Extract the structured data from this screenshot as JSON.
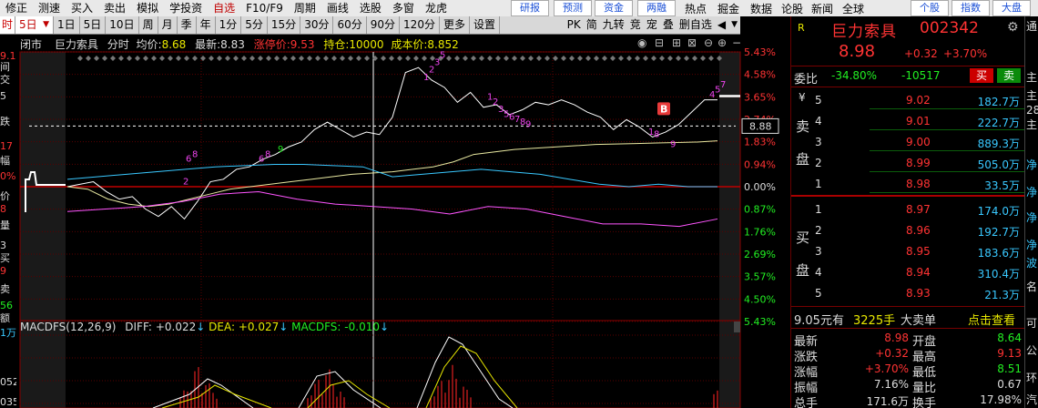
{
  "menu": {
    "items": [
      "修正",
      "测速",
      "买入",
      "卖出",
      "模拟",
      "学投资",
      "自选",
      "F10/F9",
      "周期",
      "画线",
      "选股",
      "多窗",
      "龙虎"
    ],
    "right_buttons": [
      "研报",
      "预测",
      "资金",
      "两融"
    ],
    "right_items": [
      "热点",
      "掘金",
      "数据",
      "论股",
      "新闻",
      "全球"
    ],
    "far_buttons": [
      "个股",
      "指数",
      "大盘"
    ]
  },
  "toolbar": {
    "periods": [
      "5日",
      "1日",
      "5日",
      "10日",
      "周",
      "月",
      "季",
      "年",
      "1分",
      "5分",
      "15分",
      "30分",
      "60分",
      "90分",
      "120分",
      "更多",
      "设置"
    ],
    "active_index": 0,
    "right_items": [
      "PK",
      "简",
      "九转",
      "竞",
      "宠",
      "叠",
      "删自选"
    ]
  },
  "left_strip": {
    "top_tab": "时",
    "items": [
      {
        "t": "9.13",
        "c": "#ff3333"
      },
      {
        "t": "间",
        "c": "#ddd"
      },
      {
        "t": "交",
        "c": "#ddd"
      },
      {
        "t": "5",
        "c": "#ddd"
      },
      {
        "t": "跌",
        "c": "#ddd"
      },
      {
        "t": "17",
        "c": "#ff3333"
      },
      {
        "t": "幅",
        "c": "#ddd"
      },
      {
        "t": "0%",
        "c": "#ff3333"
      },
      {
        "t": "价",
        "c": "#ddd"
      },
      {
        "t": "8",
        "c": "#ff3333"
      },
      {
        "t": "量",
        "c": "#ddd"
      },
      {
        "t": "3",
        "c": "#ddd"
      },
      {
        "t": "买",
        "c": "#ddd"
      },
      {
        "t": "9",
        "c": "#ff3333"
      },
      {
        "t": "卖",
        "c": "#ddd"
      },
      {
        "t": "56",
        "c": "#22ee22"
      },
      {
        "t": "额",
        "c": "#ddd"
      },
      {
        "t": "1万",
        "c": "#39c8ff"
      },
      {
        "t": "052",
        "c": "#ddd"
      },
      {
        "t": "035",
        "c": "#ddd"
      },
      {
        "t": "017",
        "c": "#ddd"
      }
    ]
  },
  "chart_header": {
    "status": "闭市",
    "name": "巨力索具",
    "mode": "分时",
    "avg_label": "均价:",
    "avg_value": "8.68",
    "last_label": "最新:",
    "last_value": "8.83",
    "limit_label": "涨停价:",
    "limit_value": "9.53",
    "pos_label": "持仓:",
    "pos_value": "10000",
    "cost_label": "成本价:",
    "cost_value": "8.852"
  },
  "macd_header": {
    "name": "MACDFS(12,26,9)",
    "diff_label": "DIFF:",
    "diff_value": "+0.022",
    "dea_label": "DEA:",
    "dea_value": "+0.027",
    "macd_label": "MACDFS:",
    "macd_value": "-0.010"
  },
  "chart_data": {
    "type": "line",
    "right_axis": [
      "5.43%",
      "4.58%",
      "3.65%",
      "2.74%",
      "1.83%",
      "0.94%",
      "0.00%",
      "0.87%",
      "1.76%",
      "2.69%",
      "3.57%",
      "4.50%",
      "5.43%"
    ],
    "right_axis_colors": [
      "#ff3333",
      "#ff3333",
      "#ff3333",
      "#ff3333",
      "#ff3333",
      "#ff3333",
      "#ddd",
      "#22ee22",
      "#22ee22",
      "#22ee22",
      "#22ee22",
      "#22ee22",
      "#22ee22"
    ],
    "cost_box": "8.88",
    "markers": [
      {
        "label": "B",
        "kind": "buy"
      }
    ],
    "nine_turn_labels": [
      "6",
      "8",
      "2",
      "6",
      "8",
      "9",
      "1",
      "2",
      "3",
      "5",
      "1",
      "2",
      "3",
      "5",
      "6",
      "7",
      "8",
      "9",
      "1",
      "8",
      "9",
      "4",
      "5",
      "7"
    ],
    "series": [
      {
        "values": [
          0,
          0.1,
          0.2,
          -0.2,
          -0.5,
          -0.4,
          -0.9,
          -1.2,
          -0.8,
          -1.3,
          -0.6,
          0.2,
          0.3,
          0.7,
          0.8,
          1.1,
          1.3,
          1.6,
          1.8,
          2.3,
          2.6,
          2.3,
          2.0,
          2.2,
          2.1,
          2.8,
          4.6,
          4.8,
          4.3,
          4.0,
          3.4,
          3.8,
          3.2,
          3.3,
          2.9,
          3.1,
          3.4,
          3.3,
          3.5,
          3.3,
          3.0,
          2.8,
          2.3,
          2.7,
          2.4,
          2.0,
          2.2,
          2.5,
          3.0,
          3.5,
          3.5
        ],
        "color": "#ffffff"
      },
      {
        "values": [
          0,
          -0.1,
          -0.5,
          -0.7,
          -0.8,
          -0.7,
          -0.5,
          -0.3,
          -0.1,
          0.0,
          0.1,
          0.2,
          0.3,
          0.4,
          0.5,
          0.55,
          0.6,
          0.7,
          0.8,
          1.0,
          1.3,
          1.4,
          1.5,
          1.55,
          1.6,
          1.65,
          1.7,
          1.72,
          1.74,
          1.76,
          1.78,
          1.8,
          1.85
        ],
        "color": "#e8e8a0"
      },
      {
        "values": [
          0.3,
          0.4,
          0.5,
          0.6,
          0.7,
          0.8,
          0.85,
          0.9,
          0.9,
          0.85,
          0.8,
          0.4,
          0.5,
          0.6,
          0.7,
          0.6,
          0.5,
          0.3,
          0.1,
          0.0,
          0.1,
          0.0,
          0.0
        ],
        "color": "#39c8ff"
      },
      {
        "values": [
          -1.0,
          -0.9,
          -0.8,
          -0.6,
          -0.3,
          -0.2,
          -0.5,
          -0.7,
          -0.8,
          -0.9,
          -1.1,
          -0.8,
          -0.9,
          -1.2,
          -1.5,
          -1.5,
          -1.6,
          -1.3
        ],
        "color": "#ff55ff"
      }
    ]
  },
  "right_panel": {
    "badge": "R",
    "name": "巨力索具",
    "code": "002342",
    "price": "8.98",
    "change": "+0.32",
    "change_pct": "+3.70%",
    "webi_label": "委比",
    "webi_value": "-34.80%",
    "webi_diff": "-10517",
    "buy_btn": "买",
    "sell_btn": "卖",
    "sell_label": [
      "卖",
      "盘"
    ],
    "buy_label": [
      "买",
      "盘"
    ],
    "yen": "¥",
    "asks": [
      {
        "lvl": "5",
        "price": "9.02",
        "vol": "182.7万"
      },
      {
        "lvl": "4",
        "price": "9.01",
        "vol": "222.7万"
      },
      {
        "lvl": "3",
        "price": "9.00",
        "vol": "889.3万"
      },
      {
        "lvl": "2",
        "price": "8.99",
        "vol": "505.0万"
      },
      {
        "lvl": "1",
        "price": "8.98",
        "vol": "33.5万"
      }
    ],
    "bids": [
      {
        "lvl": "1",
        "price": "8.97",
        "vol": "174.0万"
      },
      {
        "lvl": "2",
        "price": "8.96",
        "vol": "192.7万"
      },
      {
        "lvl": "3",
        "price": "8.95",
        "vol": "183.6万"
      },
      {
        "lvl": "4",
        "price": "8.94",
        "vol": "310.4万"
      },
      {
        "lvl": "5",
        "price": "8.93",
        "vol": "21.3万"
      }
    ],
    "big_order": {
      "price": "9.05元有",
      "vol": "3225手",
      "label": "大卖单",
      "link": "点击查看"
    },
    "stats": [
      {
        "l1": "最新",
        "v1": "8.98",
        "c1": "red",
        "l2": "开盘",
        "v2": "8.64",
        "c2": "grn"
      },
      {
        "l1": "涨跌",
        "v1": "+0.32",
        "c1": "red",
        "l2": "最高",
        "v2": "9.13",
        "c2": "red"
      },
      {
        "l1": "涨幅",
        "v1": "+3.70%",
        "c1": "red",
        "l2": "最低",
        "v2": "8.51",
        "c2": "grn"
      },
      {
        "l1": "振幅",
        "v1": "7.16%",
        "c1": "wht",
        "l2": "量比",
        "v2": "0.67",
        "c2": "wht"
      },
      {
        "l1": "总手",
        "v1": "171.6万",
        "c1": "wht",
        "l2": "换手",
        "v2": "17.98%",
        "c2": "wht"
      }
    ]
  },
  "far_right": {
    "items": [
      "通",
      "主",
      "主",
      "28",
      "主",
      "净",
      "净",
      "净",
      "净",
      "波",
      "名",
      "可",
      "公",
      "环",
      "汽"
    ]
  }
}
